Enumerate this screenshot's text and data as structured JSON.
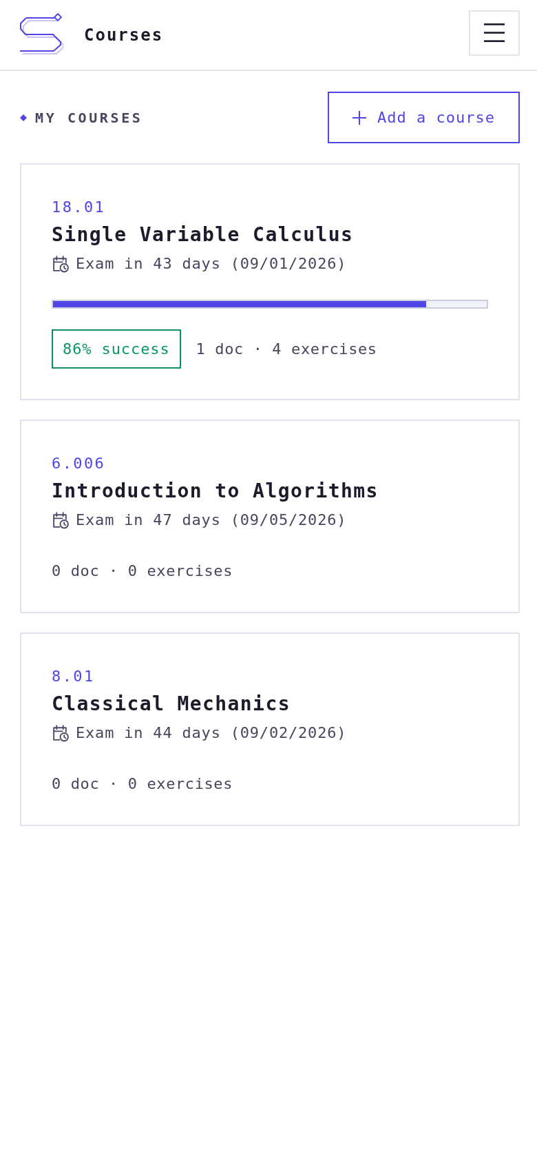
{
  "header": {
    "title": "Courses"
  },
  "section": {
    "title": "MY COURSES",
    "add_button": {
      "label": "Add a course"
    }
  },
  "courses": [
    {
      "code": "18.01",
      "name": "Single Variable Calculus",
      "exam": "Exam in 43 days (09/01/2026)",
      "level": 0.86,
      "success": "86% success",
      "meta": "1 doc · 4 exercises"
    },
    {
      "code": "6.006",
      "name": "Introduction to Algorithms",
      "exam": "Exam in 47 days (09/05/2026)",
      "meta": "0 doc · 0 exercises"
    },
    {
      "code": "8.01",
      "name": "Classical Mechanics",
      "exam": "Exam in 44 days (09/02/2026)",
      "meta": "0 doc · 0 exercises"
    }
  ]
}
